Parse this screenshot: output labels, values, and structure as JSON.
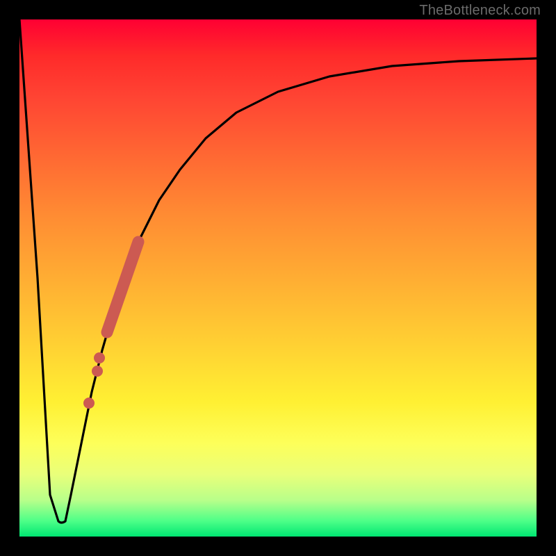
{
  "watermark": "TheBottleneck.com",
  "chart_data": {
    "type": "line",
    "title": "",
    "xlabel": "",
    "ylabel": "",
    "xlim": [
      0,
      1
    ],
    "ylim": [
      0,
      1
    ],
    "series": [
      {
        "name": "bottleneck-curve",
        "x": [
          0.0,
          0.035,
          0.06,
          0.075,
          0.085,
          0.1,
          0.12,
          0.14,
          0.16,
          0.18,
          0.2,
          0.23,
          0.27,
          0.31,
          0.36,
          0.42,
          0.5,
          0.6,
          0.72,
          0.85,
          1.0
        ],
        "y": [
          1.0,
          0.5,
          0.08,
          0.03,
          0.03,
          0.08,
          0.18,
          0.28,
          0.36,
          0.43,
          0.49,
          0.57,
          0.65,
          0.71,
          0.77,
          0.82,
          0.86,
          0.89,
          0.91,
          0.92,
          0.925
        ]
      },
      {
        "name": "marker-band",
        "x": [
          0.17,
          0.23
        ],
        "y": [
          0.395,
          0.57
        ]
      }
    ],
    "markers": [
      {
        "x": 0.15,
        "y": 0.32
      },
      {
        "x": 0.155,
        "y": 0.345
      },
      {
        "x": 0.135,
        "y": 0.258
      }
    ],
    "background_gradient": {
      "top": "#ff0033",
      "mid_upper": "#ff8c33",
      "mid": "#ffce33",
      "mid_lower": "#fdff5a",
      "bottom": "#00e672"
    }
  }
}
